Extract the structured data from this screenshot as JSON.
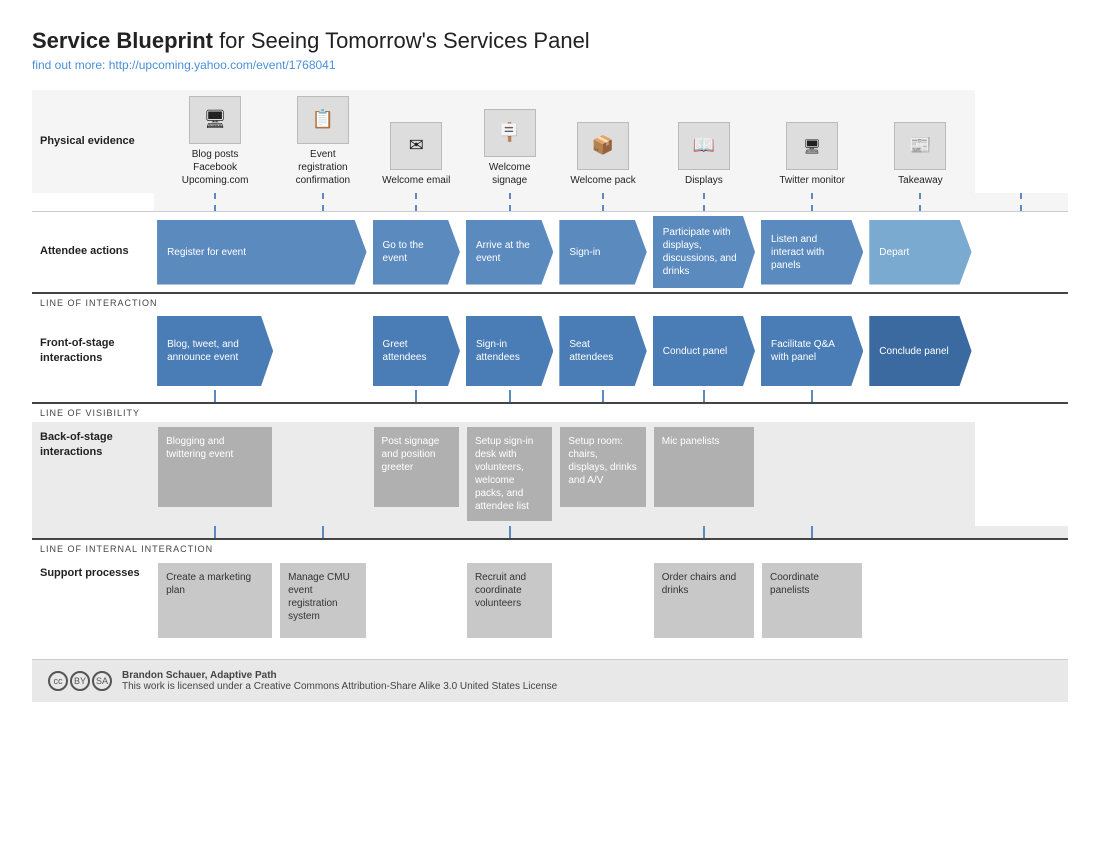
{
  "title": {
    "main": "Service Blueprint",
    "suffix": " for Seeing Tomorrow's Services Panel"
  },
  "subtitle": "find out more: http://upcoming.yahoo.com/event/1768041",
  "sections": {
    "physical_evidence": "Physical evidence",
    "attendee_actions": "Attendee actions",
    "front_of_stage": "Front-of-stage interactions",
    "back_of_stage": "Back-of-stage interactions",
    "support": "Support processes"
  },
  "separators": {
    "interaction": "LINE OF INTERACTION",
    "visibility": "LINE OF VISIBILITY",
    "internal": "LINE OF INTERNAL INTERACTION"
  },
  "physical_items": [
    {
      "icon": "🖥",
      "label": "Blog posts\nFacebook\nUpcoming.com"
    },
    {
      "icon": "📋",
      "label": "Event\nregistration\nconfirmation"
    },
    {
      "icon": "✉",
      "label": "Welcome email"
    },
    {
      "icon": "🪧",
      "label": "Welcome\nsignage"
    },
    {
      "icon": "📦",
      "label": "Welcome pack"
    },
    {
      "icon": "📖",
      "label": "Displays"
    },
    {
      "icon": "🖥",
      "label": "Twitter monitor"
    },
    {
      "icon": "📰",
      "label": "Takeaway"
    }
  ],
  "attendee_actions": [
    {
      "label": "Register for event",
      "span": 2
    },
    {
      "label": "Go to the event"
    },
    {
      "label": "Arrive at the event"
    },
    {
      "label": "Sign-in"
    },
    {
      "label": "Participate with displays, discussions, and drinks"
    },
    {
      "label": "Listen and interact with panels"
    },
    {
      "label": "Depart"
    }
  ],
  "front_stage": [
    {
      "label": "Blog, tweet, and announce event",
      "span": 1
    },
    {
      "label": ""
    },
    {
      "label": "Greet attendees"
    },
    {
      "label": "Sign-in attendees"
    },
    {
      "label": "Seat attendees"
    },
    {
      "label": "Conduct panel"
    },
    {
      "label": "Facilitate Q&A with panel"
    },
    {
      "label": "Conclude panel"
    }
  ],
  "back_stage": [
    {
      "label": "Blogging and twittering event"
    },
    {
      "label": ""
    },
    {
      "label": "Post signage and position greeter"
    },
    {
      "label": "Setup sign-in desk with volunteers, welcome packs, and attendee list"
    },
    {
      "label": "Setup room: chairs, displays, drinks and A/V"
    },
    {
      "label": "Mic panelists"
    },
    {
      "label": ""
    }
  ],
  "support": [
    {
      "label": "Create a marketing plan"
    },
    {
      "label": "Manage CMU event registration system"
    },
    {
      "label": ""
    },
    {
      "label": "Recruit and coordinate volunteers"
    },
    {
      "label": ""
    },
    {
      "label": "Order chairs and drinks"
    },
    {
      "label": "Coordinate panelists"
    },
    {
      "label": ""
    }
  ],
  "footer": {
    "author": "Brandon Schauer, Adaptive Path",
    "license": "This work is licensed under a Creative Commons Attribution-Share Alike 3.0 United States License"
  }
}
